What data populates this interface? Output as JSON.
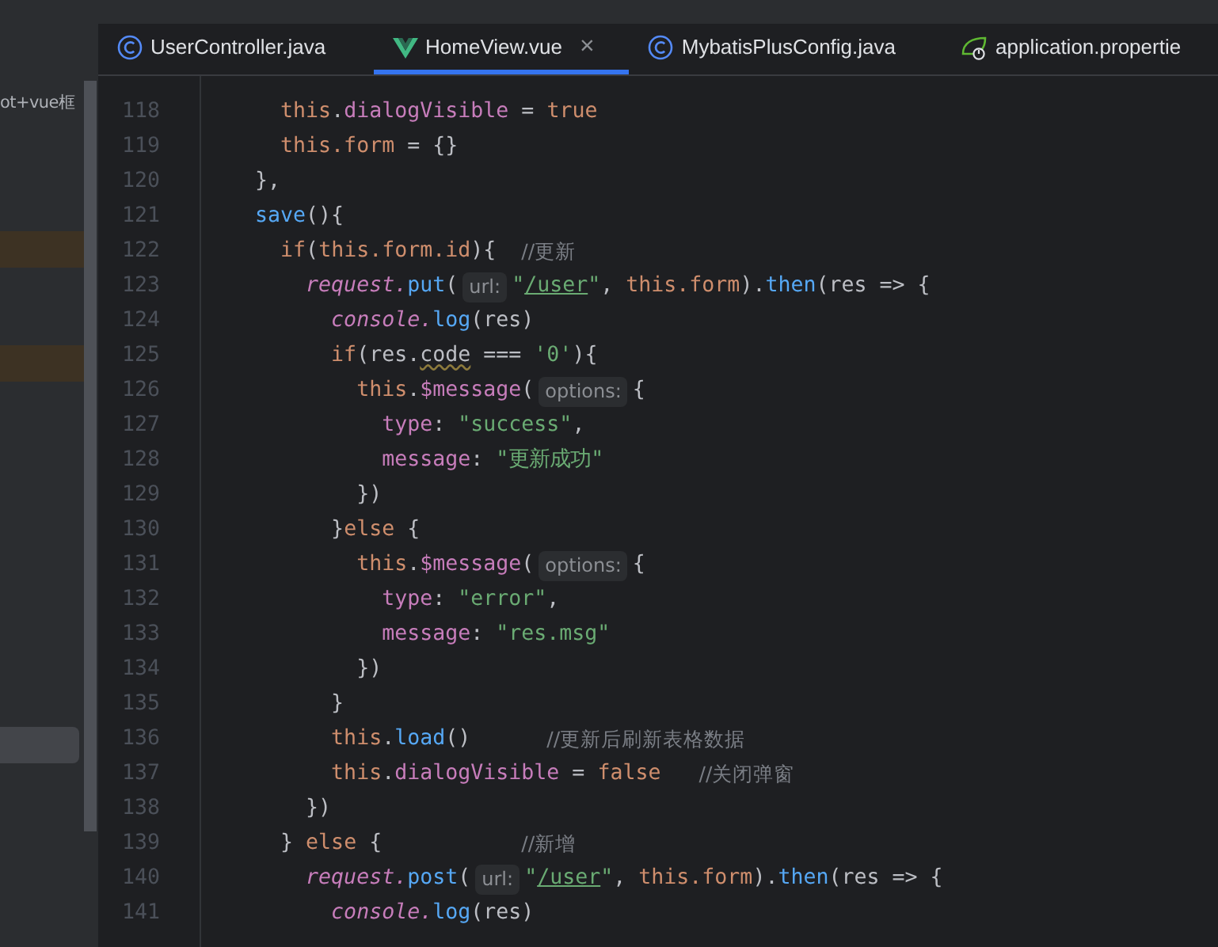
{
  "sidebar": {
    "title": "ot+vue框",
    "rows": [
      {
        "kind": "changed"
      },
      {
        "kind": "changed"
      },
      {
        "kind": "selected"
      }
    ]
  },
  "tabs": [
    {
      "label": "UserController.java",
      "kind": "class",
      "selected": false,
      "closable": false
    },
    {
      "label": "HomeView.vue",
      "kind": "vue",
      "selected": true,
      "closable": true,
      "close": "×"
    },
    {
      "label": "MybatisPlusConfig.java",
      "kind": "class",
      "selected": false,
      "closable": false
    },
    {
      "label": "application.propertie",
      "kind": "properties",
      "selected": false,
      "closable": false
    }
  ],
  "editor": {
    "lines": [
      {
        "number": "118",
        "tokens": [
          {
            "kind": "this",
            "text": "      this"
          },
          {
            "kind": "plain",
            "text": "."
          },
          {
            "kind": "field",
            "text": "dialogVisible"
          },
          {
            "kind": "plain",
            "text": " = "
          },
          {
            "kind": "keyword",
            "text": "true"
          }
        ]
      },
      {
        "number": "119",
        "tokens": [
          {
            "kind": "this",
            "text": "      this.form"
          },
          {
            "kind": "plain",
            "text": " = {}"
          }
        ]
      },
      {
        "number": "120",
        "tokens": [
          {
            "kind": "plain",
            "text": "    },"
          }
        ]
      },
      {
        "number": "121",
        "tokens": [
          {
            "kind": "func",
            "text": "    save"
          },
          {
            "kind": "plain",
            "text": "(){"
          }
        ]
      },
      {
        "number": "122",
        "tokens": [
          {
            "kind": "keyword",
            "text": "      if"
          },
          {
            "kind": "plain",
            "text": "("
          },
          {
            "kind": "this",
            "text": "this.form.id"
          },
          {
            "kind": "plain",
            "text": "){  "
          },
          {
            "kind": "comment",
            "text": "//更新"
          }
        ]
      },
      {
        "number": "123",
        "tokens": [
          {
            "kind": "ident",
            "text": "        request."
          },
          {
            "kind": "func",
            "text": "put"
          },
          {
            "kind": "plain",
            "text": "("
          },
          {
            "kind": "hint",
            "text": "url:"
          },
          {
            "kind": "string",
            "text": "\""
          },
          {
            "kind": "path",
            "text": "/user"
          },
          {
            "kind": "string",
            "text": "\""
          },
          {
            "kind": "plain",
            "text": ", "
          },
          {
            "kind": "this",
            "text": "this.form"
          },
          {
            "kind": "plain",
            "text": ")."
          },
          {
            "kind": "func",
            "text": "then"
          },
          {
            "kind": "plain",
            "text": "(res => {"
          }
        ]
      },
      {
        "number": "124",
        "tokens": [
          {
            "kind": "ident",
            "text": "          console."
          },
          {
            "kind": "func",
            "text": "log"
          },
          {
            "kind": "plain",
            "text": "(res)"
          }
        ]
      },
      {
        "number": "125",
        "tokens": [
          {
            "kind": "keyword",
            "text": "          if"
          },
          {
            "kind": "plain",
            "text": "(res."
          },
          {
            "kind": "warn",
            "text": "code"
          },
          {
            "kind": "plain",
            "text": " === "
          },
          {
            "kind": "string",
            "text": "'0'"
          },
          {
            "kind": "plain",
            "text": "){"
          }
        ]
      },
      {
        "number": "126",
        "tokens": [
          {
            "kind": "this",
            "text": "            this"
          },
          {
            "kind": "plain",
            "text": "."
          },
          {
            "kind": "field",
            "text": "$message"
          },
          {
            "kind": "plain",
            "text": "("
          },
          {
            "kind": "hint",
            "text": "options:"
          },
          {
            "kind": "plain",
            "text": "{"
          }
        ]
      },
      {
        "number": "127",
        "tokens": [
          {
            "kind": "field",
            "text": "              type"
          },
          {
            "kind": "plain",
            "text": ": "
          },
          {
            "kind": "string",
            "text": "\"success\""
          },
          {
            "kind": "plain",
            "text": ","
          }
        ]
      },
      {
        "number": "128",
        "tokens": [
          {
            "kind": "field",
            "text": "              message"
          },
          {
            "kind": "plain",
            "text": ": "
          },
          {
            "kind": "string",
            "text": "\"更新成功\""
          }
        ]
      },
      {
        "number": "129",
        "tokens": [
          {
            "kind": "plain",
            "text": "            })"
          }
        ]
      },
      {
        "number": "130",
        "tokens": [
          {
            "kind": "plain",
            "text": "          }"
          },
          {
            "kind": "keyword",
            "text": "else"
          },
          {
            "kind": "plain",
            "text": " {"
          }
        ]
      },
      {
        "number": "131",
        "tokens": [
          {
            "kind": "this",
            "text": "            this"
          },
          {
            "kind": "plain",
            "text": "."
          },
          {
            "kind": "field",
            "text": "$message"
          },
          {
            "kind": "plain",
            "text": "("
          },
          {
            "kind": "hint",
            "text": "options:"
          },
          {
            "kind": "plain",
            "text": "{"
          }
        ]
      },
      {
        "number": "132",
        "tokens": [
          {
            "kind": "field",
            "text": "              type"
          },
          {
            "kind": "plain",
            "text": ": "
          },
          {
            "kind": "string",
            "text": "\"error\""
          },
          {
            "kind": "plain",
            "text": ","
          }
        ]
      },
      {
        "number": "133",
        "tokens": [
          {
            "kind": "field",
            "text": "              message"
          },
          {
            "kind": "plain",
            "text": ": "
          },
          {
            "kind": "string",
            "text": "\"res.msg\""
          }
        ]
      },
      {
        "number": "134",
        "tokens": [
          {
            "kind": "plain",
            "text": "            })"
          }
        ]
      },
      {
        "number": "135",
        "tokens": [
          {
            "kind": "plain",
            "text": "          }"
          }
        ]
      },
      {
        "number": "136",
        "tokens": [
          {
            "kind": "this",
            "text": "          this"
          },
          {
            "kind": "plain",
            "text": "."
          },
          {
            "kind": "func",
            "text": "load"
          },
          {
            "kind": "plain",
            "text": "()      "
          },
          {
            "kind": "comment",
            "text": "//更新后刷新表格数据"
          }
        ]
      },
      {
        "number": "137",
        "tokens": [
          {
            "kind": "this",
            "text": "          this"
          },
          {
            "kind": "plain",
            "text": "."
          },
          {
            "kind": "field",
            "text": "dialogVisible"
          },
          {
            "kind": "plain",
            "text": " = "
          },
          {
            "kind": "keyword",
            "text": "false   "
          },
          {
            "kind": "comment",
            "text": "//关闭弹窗"
          }
        ]
      },
      {
        "number": "138",
        "tokens": [
          {
            "kind": "plain",
            "text": "        })"
          }
        ]
      },
      {
        "number": "139",
        "tokens": [
          {
            "kind": "plain",
            "text": "      } "
          },
          {
            "kind": "keyword",
            "text": "else"
          },
          {
            "kind": "plain",
            "text": " {           "
          },
          {
            "kind": "comment",
            "text": "//新增"
          }
        ]
      },
      {
        "number": "140",
        "tokens": [
          {
            "kind": "ident",
            "text": "        request."
          },
          {
            "kind": "func",
            "text": "post"
          },
          {
            "kind": "plain",
            "text": "("
          },
          {
            "kind": "hint",
            "text": "url:"
          },
          {
            "kind": "string",
            "text": "\""
          },
          {
            "kind": "path",
            "text": "/user"
          },
          {
            "kind": "string",
            "text": "\""
          },
          {
            "kind": "plain",
            "text": ", "
          },
          {
            "kind": "this",
            "text": "this.form"
          },
          {
            "kind": "plain",
            "text": ")."
          },
          {
            "kind": "func",
            "text": "then"
          },
          {
            "kind": "plain",
            "text": "(res => {"
          }
        ]
      },
      {
        "number": "141",
        "tokens": [
          {
            "kind": "ident",
            "text": "          console."
          },
          {
            "kind": "func",
            "text": "log"
          },
          {
            "kind": "plain",
            "text": "(res)"
          }
        ]
      }
    ]
  }
}
